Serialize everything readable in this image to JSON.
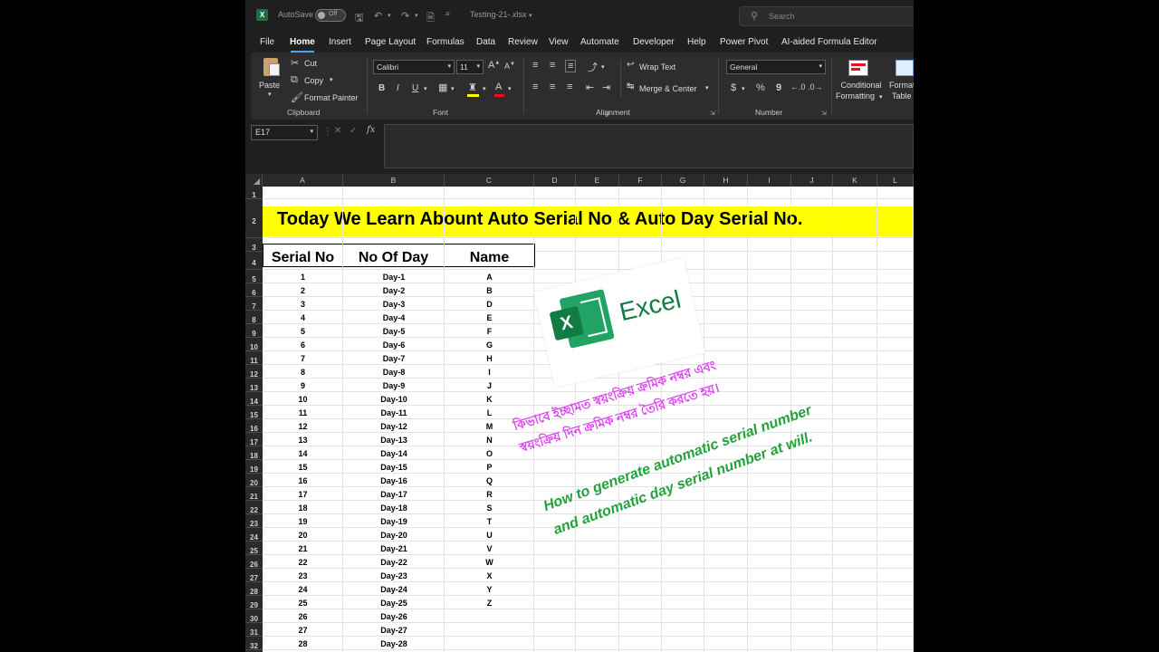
{
  "titlebar": {
    "autosave_label": "AutoSave",
    "autosave_state": "Off",
    "filename": "Testing-21-.xlsx",
    "search_placeholder": "Search"
  },
  "menu": {
    "items": [
      "File",
      "Home",
      "Insert",
      "Page Layout",
      "Formulas",
      "Data",
      "Review",
      "View",
      "Automate",
      "Developer",
      "Help",
      "Power Pivot",
      "AI-aided Formula Editor"
    ]
  },
  "ribbon": {
    "clipboard": {
      "paste": "Paste",
      "cut": "Cut",
      "copy": "Copy",
      "format_painter": "Format Painter",
      "label": "Clipboard"
    },
    "font": {
      "name": "Calibri",
      "size": "11",
      "label": "Font"
    },
    "alignment": {
      "wrap": "Wrap Text",
      "merge": "Merge & Center",
      "label": "Alignment"
    },
    "number": {
      "format": "General",
      "currency": "$",
      "percent": "%",
      "comma": "9",
      "label": "Number"
    },
    "styles": {
      "conditional_1": "Conditional",
      "conditional_2": "Formatting",
      "format_1": "Format",
      "format_2": "Table"
    }
  },
  "formula_bar": {
    "name_box": "E17",
    "formula": ""
  },
  "sheet": {
    "columns": [
      "A",
      "B",
      "C",
      "D",
      "E",
      "F",
      "G",
      "H",
      "I",
      "J",
      "K",
      "L"
    ],
    "rows": [
      "1",
      "2",
      "3",
      "4",
      "5",
      "6",
      "7",
      "8",
      "9",
      "10",
      "11",
      "12",
      "13",
      "14",
      "15",
      "16",
      "17",
      "18",
      "19",
      "20",
      "21",
      "22",
      "23",
      "24",
      "25",
      "26",
      "27",
      "28",
      "29",
      "30",
      "31",
      "32"
    ],
    "banner_title": "Today We Learn Abount Auto Serial No & Auto Day Serial No.",
    "headers": [
      "Serial No",
      "No Of Day",
      "Name"
    ],
    "serial_no": [
      "1",
      "2",
      "3",
      "4",
      "5",
      "6",
      "7",
      "8",
      "9",
      "10",
      "11",
      "12",
      "13",
      "14",
      "15",
      "16",
      "17",
      "18",
      "19",
      "20",
      "21",
      "22",
      "23",
      "24",
      "25",
      "26",
      "27",
      "28"
    ],
    "days": [
      "Day-1",
      "Day-2",
      "Day-3",
      "Day-4",
      "Day-5",
      "Day-6",
      "Day-7",
      "Day-8",
      "Day-9",
      "Day-10",
      "Day-11",
      "Day-12",
      "Day-13",
      "Day-14",
      "Day-15",
      "Day-16",
      "Day-17",
      "Day-18",
      "Day-19",
      "Day-20",
      "Day-21",
      "Day-22",
      "Day-23",
      "Day-24",
      "Day-25",
      "Day-26",
      "Day-27",
      "Day-28"
    ],
    "names": [
      "A",
      "B",
      "D",
      "E",
      "F",
      "G",
      "H",
      "I",
      "J",
      "K",
      "L",
      "M",
      "N",
      "O",
      "P",
      "Q",
      "R",
      "S",
      "T",
      "U",
      "V",
      "W",
      "X",
      "Y",
      "Z"
    ]
  },
  "overlay": {
    "excel_word": "Excel",
    "excel_tile_letter": "X",
    "bengali_line1": "কিভাবে ইচ্ছামত স্বয়ংক্রিয় ক্রমিক নম্বর এবং",
    "bengali_line2": "স্বয়ংক্রিয় দিন ক্রমিক নম্বর তৈরি করতে হয়।",
    "english_line1": "How to generate automatic serial number",
    "english_line2": "and automatic day serial number at will."
  }
}
